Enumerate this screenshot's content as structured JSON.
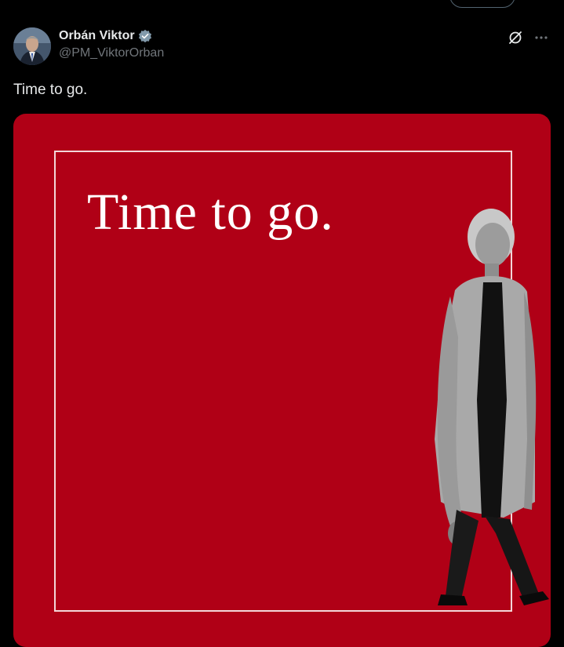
{
  "author": {
    "display_name": "Orbán Viktor",
    "handle": "@PM_ViktorOrban",
    "verified": true
  },
  "icons": {
    "verified": "verified-badge-icon",
    "grok": "grok-icon",
    "more": "more-icon"
  },
  "tweet": {
    "text": "Time to go."
  },
  "media": {
    "poster_text": "Time to go.",
    "background_color": "#b00016",
    "frame_color": "#f3d6d9",
    "text_color": "#ffffff"
  }
}
